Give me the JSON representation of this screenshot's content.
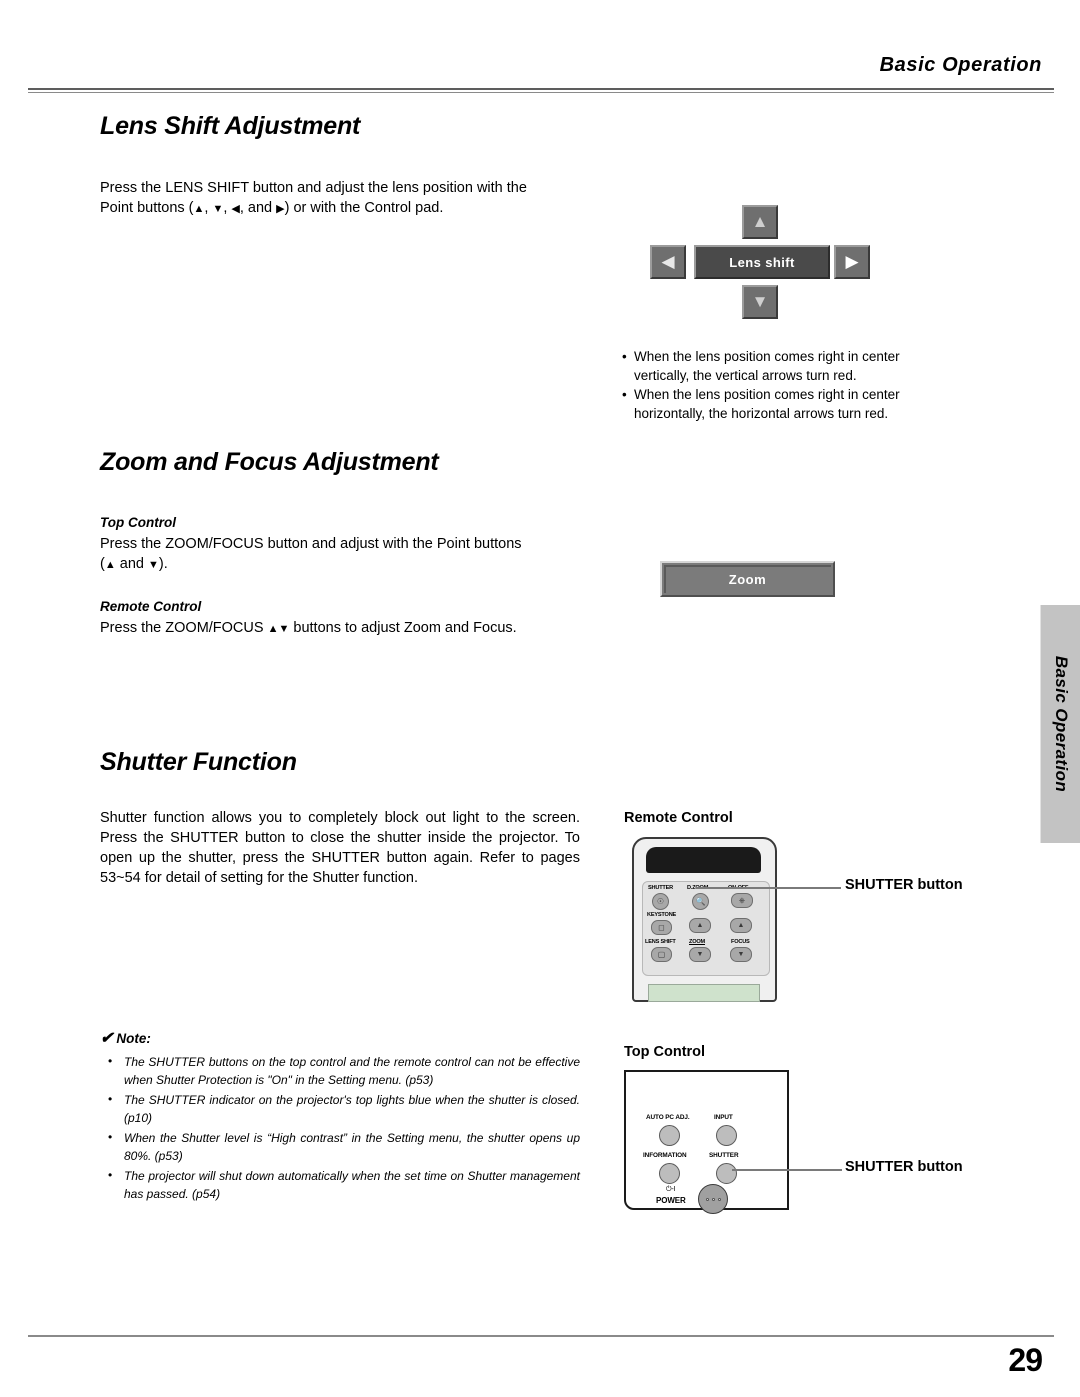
{
  "header": {
    "title": "Basic Operation"
  },
  "side_tab": {
    "label": "Basic Operation"
  },
  "footer": {
    "page_number": "29"
  },
  "sections": {
    "lens_shift": {
      "title": "Lens Shift Adjustment",
      "body_line1": "Press the LENS SHIFT button and adjust the lens position with the",
      "body_line2_pre": "Point buttons (",
      "body_line2_mid": ", and",
      "body_line2_post": ") or with the Control pad.",
      "osd": {
        "label": "Lens shift",
        "up_icon": "arrow-up-icon",
        "down_icon": "arrow-down-icon",
        "left_icon": "arrow-left-icon",
        "right_icon": "arrow-right-icon"
      },
      "notes": [
        "When the lens position comes right in center",
        "vertically, the vertical arrows turn red.",
        "When the lens position comes right in center",
        "horizontally, the horizontal arrows turn red."
      ]
    },
    "zoom_focus": {
      "title": "Zoom and Focus Adjustment",
      "top_control_heading": "Top Control",
      "top_control_line1": "Press the ZOOM/FOCUS button and adjust with the Point buttons",
      "top_control_line2_pre": "(",
      "top_control_line2_mid": " and ",
      "top_control_line2_post": ").",
      "remote_control_heading": "Remote Control",
      "remote_control_line_pre": "Press the ZOOM/FOCUS ",
      "remote_control_line_post": " buttons to adjust Zoom and Focus.",
      "osd_label": "Zoom"
    },
    "shutter": {
      "title": "Shutter Function",
      "body": "Shutter function allows you to completely block out light to the screen. Press the SHUTTER button to close the shutter inside the projector. To open up the shutter, press the SHUTTER button again. Refer to pages 53~54 for detail of setting for the Shutter function."
    }
  },
  "note_block": {
    "heading": "Note:",
    "check_glyph": "✔",
    "items": [
      "The SHUTTER buttons on the top control and the remote control can not be effective when Shutter Protection is \"On\" in the Setting menu. (p53)",
      "The SHUTTER indicator on the projector's top lights blue when the shutter is closed. (p10)",
      "When the Shutter level is “High contrast” in the Setting menu, the shutter opens up 80%. (p53)",
      "The projector will shut down automatically when the set time on Shutter management has passed. (p54)"
    ]
  },
  "remote_figure": {
    "heading": "Remote Control",
    "callout": "SHUTTER button",
    "buttons": {
      "shutter": "SHUTTER",
      "dzoom": "D.ZOOM",
      "onoff": "ON-OFF",
      "keystone": "KEYSTONE",
      "lens_shift": "LENS SHIFT",
      "zoom": "ZOOM",
      "focus": "FOCUS"
    }
  },
  "topcontrol_figure": {
    "heading": "Top Control",
    "callout": "SHUTTER button",
    "buttons": {
      "auto_pc_adj": "AUTO PC ADJ.",
      "input": "INPUT",
      "information": "INFORMATION",
      "shutter": "SHUTTER",
      "power": "POWER",
      "power_symbol": "⏻-I"
    }
  },
  "glyphs": {
    "tri_up": "▲",
    "tri_down": "▼",
    "tri_left": "◀",
    "tri_right": "▶",
    "bullet": "•"
  },
  "colors": {
    "osd_bar": "#4a4a4a",
    "osd_button": "#6f6f6f",
    "zoom_bar": "#7b7b7b",
    "side_tab": "#c3c3c3",
    "rule": "#8a8a8a"
  }
}
